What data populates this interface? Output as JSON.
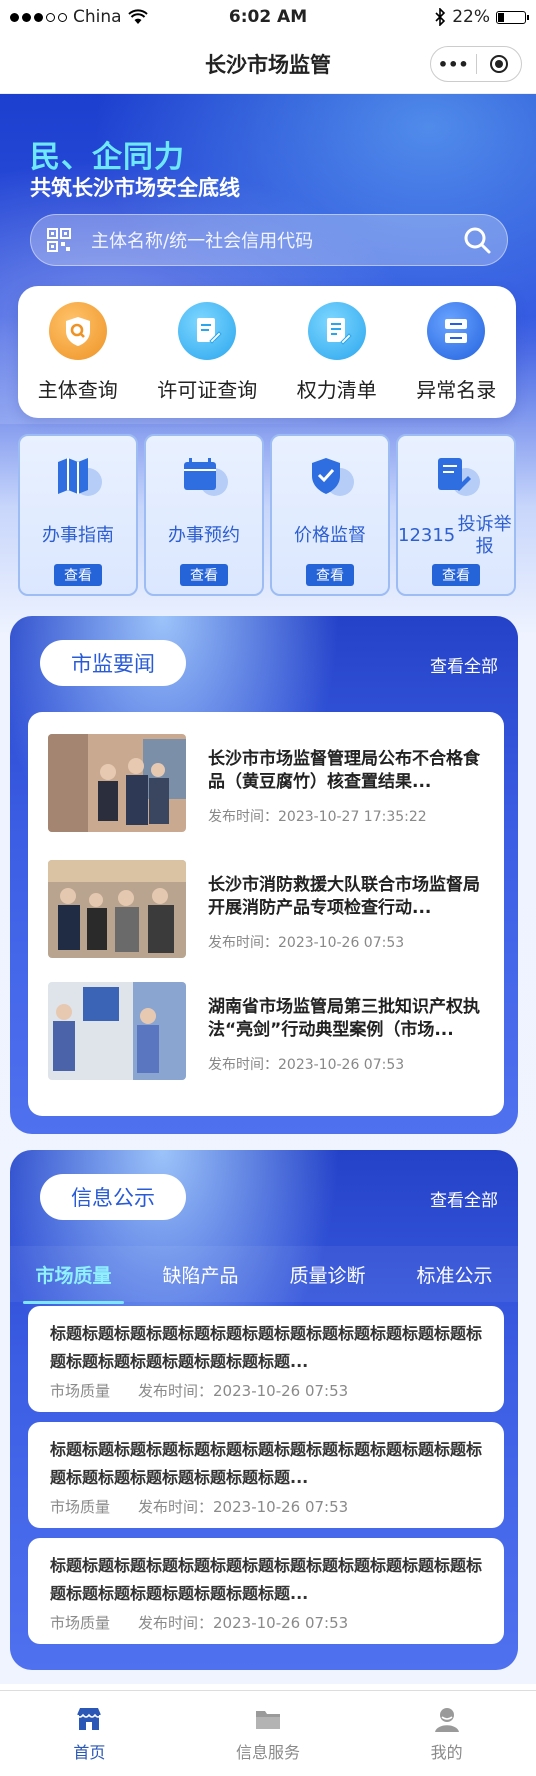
{
  "status_bar": {
    "carrier": "China",
    "time": "6:02 AM",
    "battery": "22%"
  },
  "nav": {
    "title": "长沙市场监管",
    "more_glyph": "•••"
  },
  "hero": {
    "slogan_main": "民、企同力",
    "slogan_sub": "共筑长沙市场安全底线"
  },
  "search": {
    "placeholder": "主体名称/统一社会信用代码"
  },
  "quick_actions": [
    {
      "label": "主体查询",
      "icon": "shield-search-icon",
      "color": "#f0a13a"
    },
    {
      "label": "许可证查询",
      "icon": "license-doc-icon",
      "color": "#36b2f0"
    },
    {
      "label": "权力清单",
      "icon": "list-doc-icon",
      "color": "#36b2f0"
    },
    {
      "label": "异常名录",
      "icon": "abnormal-list-icon",
      "color": "#2f74e6"
    }
  ],
  "services": [
    {
      "label": "办事指南",
      "button": "查看",
      "icon": "map-guide-icon"
    },
    {
      "label": "办事预约",
      "button": "查看",
      "icon": "calendar-icon"
    },
    {
      "label": "价格监督",
      "button": "查看",
      "icon": "shield-check-icon"
    },
    {
      "label_line1": "12315",
      "label_line2": "投诉举报",
      "button": "查看",
      "icon": "complaint-doc-icon"
    }
  ],
  "news_section": {
    "title": "市监要闻",
    "more": "查看全部",
    "items": [
      {
        "title": "长沙市市场监督管理局公布不合格食品（黄豆腐竹）核查置结果...",
        "time": "发布时间：2023-10-27 17:35:22"
      },
      {
        "title": "长沙市消防救援大队联合市场监督局开展消防产品专项检查行动...",
        "time": "发布时间：2023-10-26 07:53"
      },
      {
        "title": "湖南省市场监管局第三批知识产权执法“亮剑”行动典型案例（市场...",
        "time": "发布时间：2023-10-26 07:53"
      }
    ]
  },
  "info_section": {
    "title": "信息公示",
    "more": "查看全部",
    "tabs": [
      "市场质量",
      "缺陷产品",
      "质量诊断",
      "标准公示"
    ],
    "items": [
      {
        "title": "标题标题标题标题标题标题标题标题标题标题标题标题标题标题标题标题标题标题标题标题标题...",
        "category": "市场质量",
        "time": "发布时间：2023-10-26 07:53"
      },
      {
        "title": "标题标题标题标题标题标题标题标题标题标题标题标题标题标题标题标题标题标题标题标题标题...",
        "category": "市场质量",
        "time": "发布时间：2023-10-26 07:53"
      },
      {
        "title": "标题标题标题标题标题标题标题标题标题标题标题标题标题标题标题标题标题标题标题标题标题...",
        "category": "市场质量",
        "time": "发布时间：2023-10-26 07:53"
      }
    ]
  },
  "tab_bar": [
    {
      "label": "首页",
      "icon": "home-store-icon",
      "active": true
    },
    {
      "label": "信息服务",
      "icon": "folder-icon",
      "active": false
    },
    {
      "label": "我的",
      "icon": "user-icon",
      "active": false
    }
  ],
  "colors": {
    "brand_blue": "#2563d9",
    "accent_cyan": "#6ee8ff",
    "tab_active": "#2b57b6"
  }
}
